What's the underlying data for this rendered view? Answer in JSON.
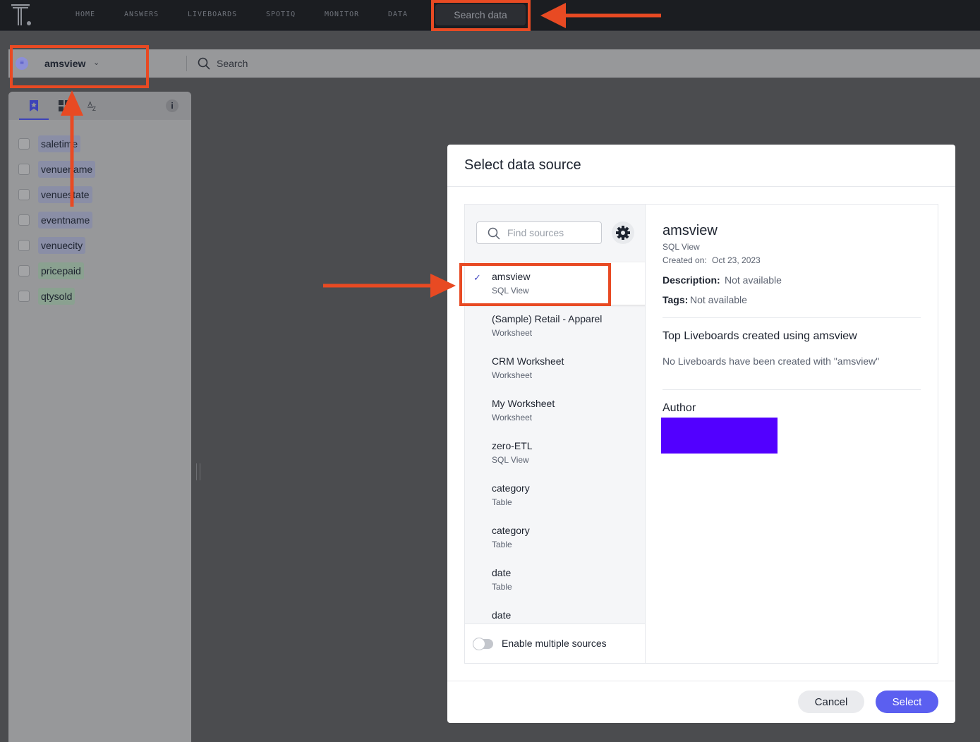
{
  "topnav": {
    "items": [
      "HOME",
      "ANSWERS",
      "LIVEBOARDS",
      "SPOTIQ",
      "MONITOR",
      "DATA"
    ],
    "search_data_label": "Search data"
  },
  "source_bar": {
    "source_name": "amsview",
    "search_label": "Search"
  },
  "left_panel": {
    "columns": [
      {
        "name": "saletime",
        "kind": "attribute"
      },
      {
        "name": "venuename",
        "kind": "attribute"
      },
      {
        "name": "venuestate",
        "kind": "attribute"
      },
      {
        "name": "eventname",
        "kind": "attribute"
      },
      {
        "name": "venuecity",
        "kind": "attribute"
      },
      {
        "name": "pricepaid",
        "kind": "measure"
      },
      {
        "name": "qtysold",
        "kind": "measure"
      }
    ],
    "info_label": "i"
  },
  "modal": {
    "title": "Select data source",
    "find_placeholder": "Find sources",
    "sources": [
      {
        "name": "amsview",
        "type": "SQL View",
        "selected": true
      },
      {
        "name": "(Sample) Retail - Apparel",
        "type": "Worksheet"
      },
      {
        "name": "CRM Worksheet",
        "type": "Worksheet"
      },
      {
        "name": "My Worksheet",
        "type": "Worksheet"
      },
      {
        "name": "zero-ETL",
        "type": "SQL View"
      },
      {
        "name": "category",
        "type": "Table"
      },
      {
        "name": "category",
        "type": "Table"
      },
      {
        "name": "date",
        "type": "Table"
      },
      {
        "name": "date",
        "type": ""
      }
    ],
    "enable_multiple_label": "Enable multiple sources",
    "detail": {
      "name": "amsview",
      "type": "SQL View",
      "created_label": "Created on:",
      "created_date": "Oct 23, 2023",
      "description_label": "Description:",
      "description": "Not available",
      "tags_label": "Tags:",
      "tags": "Not available",
      "top_liveboards_title": "Top Liveboards created using amsview",
      "no_liveboards": "No Liveboards have been created with \"amsview\"",
      "author_title": "Author"
    },
    "cancel_label": "Cancel",
    "select_label": "Select"
  },
  "colors": {
    "annotation": "#e84a23",
    "accent": "#5b5ff0",
    "author_redaction": "#5200ff"
  }
}
